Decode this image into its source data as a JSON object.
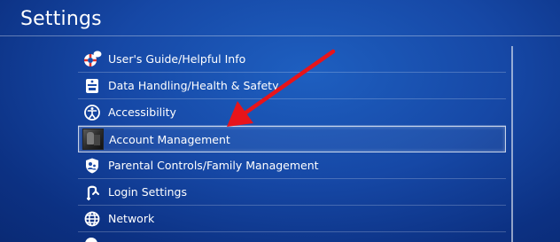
{
  "header": {
    "title": "Settings"
  },
  "menu": {
    "items": [
      {
        "label": "User's Guide/Helpful Info",
        "icon": "lifebuoy-icon"
      },
      {
        "label": "Data Handling/Health & Safety",
        "icon": "info-panel-icon"
      },
      {
        "label": "Accessibility",
        "icon": "accessibility-icon"
      },
      {
        "label": "Account Management",
        "icon": "avatar",
        "selected": true
      },
      {
        "label": "Parental Controls/Family Management",
        "icon": "parental-shield-icon"
      },
      {
        "label": "Login Settings",
        "icon": "login-icon"
      },
      {
        "label": "Network",
        "icon": "globe-icon"
      }
    ]
  },
  "annotation": {
    "arrow_color": "#e8141a"
  },
  "colors": {
    "background": "#1648a6",
    "text": "#ffffff",
    "arrow": "#e8141a"
  }
}
